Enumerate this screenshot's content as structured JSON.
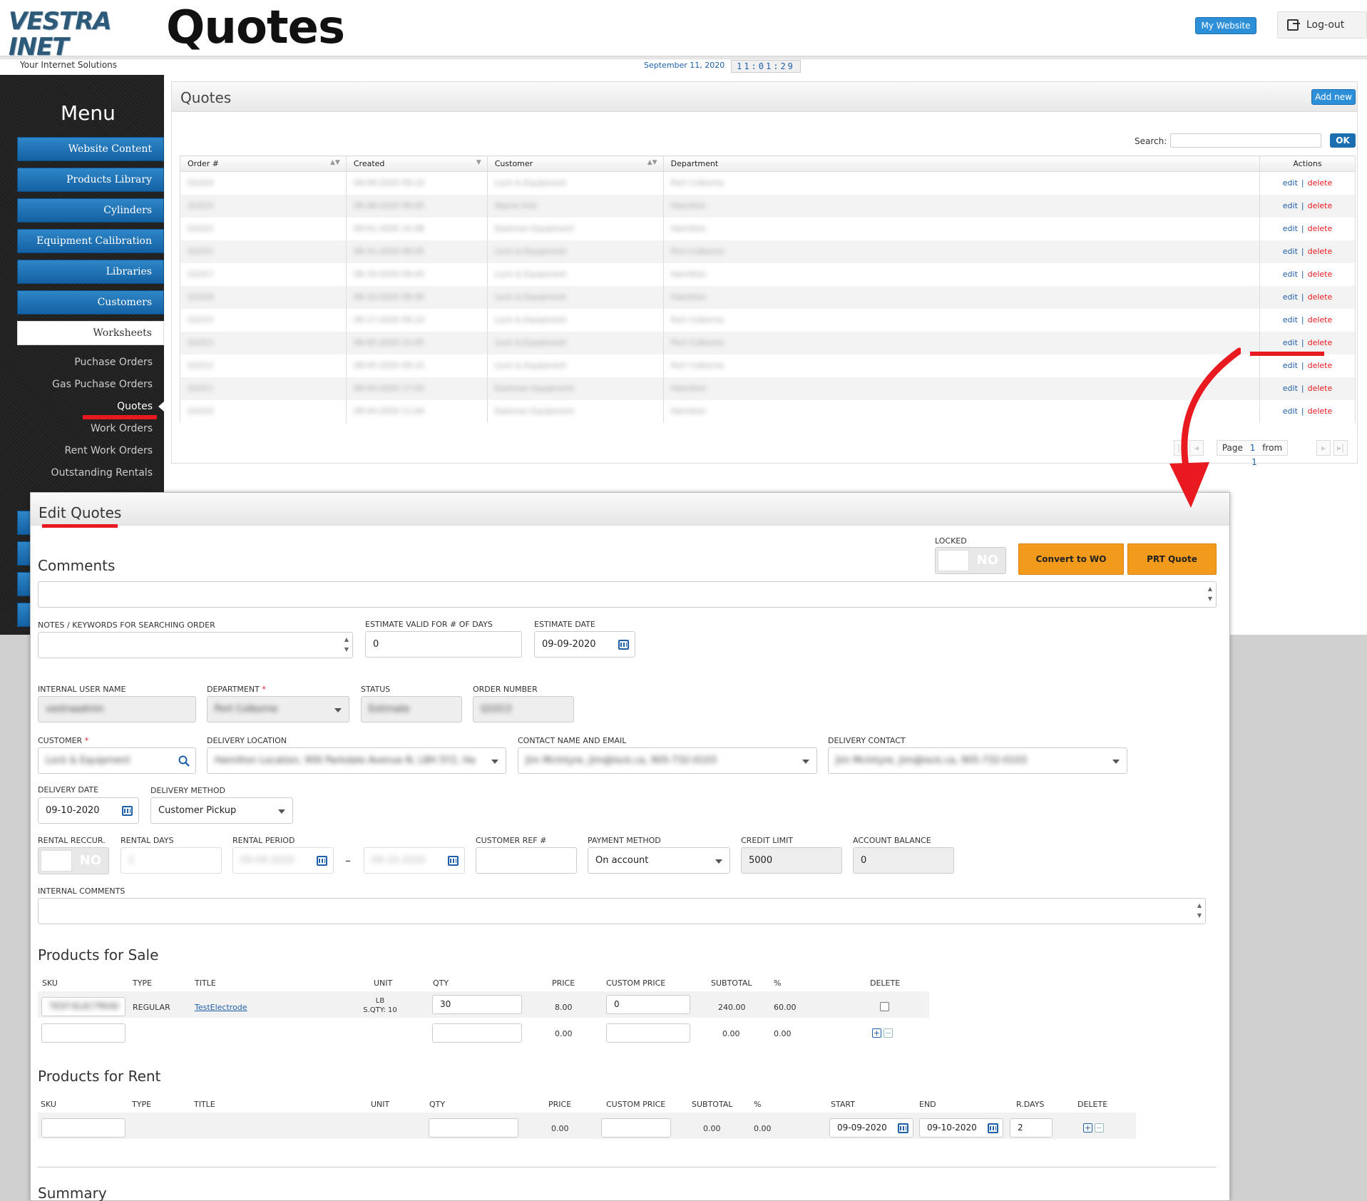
{
  "header": {
    "logo_text": "VESTRA INET",
    "logo_tagline": "Your Internet Solutions",
    "page_title": "Quotes",
    "my_website_label": "My Website",
    "logout_label": "Log-out",
    "date": "September 11, 2020",
    "time": "11:01:29"
  },
  "sidebar": {
    "title": "Menu",
    "buttons": [
      {
        "label": "Website Content"
      },
      {
        "label": "Products Library"
      },
      {
        "label": "Cylinders"
      },
      {
        "label": "Equipment Calibration"
      },
      {
        "label": "Libraries"
      },
      {
        "label": "Customers"
      },
      {
        "label": "Worksheets",
        "active": true
      }
    ],
    "subitems": [
      {
        "label": "Puchase Orders"
      },
      {
        "label": "Gas Puchase Orders"
      },
      {
        "label": "Quotes",
        "current": true
      },
      {
        "label": "Work Orders"
      },
      {
        "label": "Rent Work Orders"
      },
      {
        "label": "Outstanding Rentals"
      }
    ]
  },
  "quotes_panel": {
    "title": "Quotes",
    "add_new_label": "Add new",
    "search_label": "Search:",
    "search_value": "",
    "ok_label": "OK",
    "columns": [
      "Order #",
      "Created",
      "Customer",
      "Department",
      "Actions"
    ],
    "rows": [
      {
        "order": "Q1024",
        "created": "09-09-2020 09:10",
        "customer": "Lock & Equipment",
        "department": "Port Colborne"
      },
      {
        "order": "Q1023",
        "created": "09-08-2020 09:05",
        "customer": "Alpine Inet",
        "department": "Hamilton"
      },
      {
        "order": "Q1022",
        "created": "09-01-2020 10:48",
        "customer": "Eastman Equipment",
        "department": "Hamilton"
      },
      {
        "order": "Q1021",
        "created": "08-31-2020 09:05",
        "customer": "Lock & Equipment",
        "department": "Port Colborne"
      },
      {
        "order": "Q1017",
        "created": "08-19-2020 09:45",
        "customer": "Lock & Equipment",
        "department": "Hamilton"
      },
      {
        "order": "Q1016",
        "created": "08-19-2020 09:30",
        "customer": "Lock & Equipment",
        "department": "Hamilton"
      },
      {
        "order": "Q1015",
        "created": "08-17-2020 09:10",
        "customer": "Lock & Equipment",
        "department": "Port Colborne"
      },
      {
        "order": "Q1013",
        "created": "08-05-2020 15:05",
        "customer": "Lock & Equipment",
        "department": "Port Colborne"
      },
      {
        "order": "Q1012",
        "created": "08-05-2020 09:15",
        "customer": "Lock & Equipment",
        "department": "Port Colborne"
      },
      {
        "order": "Q1011",
        "created": "08-04-2020 17:02",
        "customer": "Eastman Equipment",
        "department": "Hamilton"
      },
      {
        "order": "Q1010",
        "created": "08-04-2020 11:04",
        "customer": "Eastman Equipment",
        "department": "Hamilton"
      }
    ],
    "edit_label": "edit",
    "delete_label": "delete",
    "separator": "|",
    "pager": {
      "page_label": "Page",
      "page": "1",
      "from_label": "from",
      "total": "1"
    }
  },
  "edit_quotes": {
    "title": "Edit Quotes",
    "locked_label": "LOCKED",
    "locked_value": "NO",
    "convert_label": "Convert to WO",
    "prt_label": "PRT Quote",
    "comments_title": "Comments",
    "notes_label": "NOTES / KEYWORDS FOR SEARCHING ORDER",
    "estimate_valid_label": "ESTIMATE VALID FOR # OF DAYS",
    "estimate_valid_value": "0",
    "estimate_date_label": "ESTIMATE DATE",
    "estimate_date_value": "09-09-2020",
    "internal_user_label": "INTERNAL USER NAME",
    "internal_user_value": "vestraadmin",
    "department_label": "DEPARTMENT",
    "department_value": "Port Colborne",
    "status_label": "STATUS",
    "status_value": "Estimate",
    "order_number_label": "ORDER NUMBER",
    "order_number_value": "Q1013",
    "customer_label": "CUSTOMER",
    "customer_value": "Lock & Equipment",
    "delivery_location_label": "DELIVERY LOCATION",
    "delivery_location_value": "Hamilton Location, 900 Parkdale Avenue N, L8H 5Y2, Ha",
    "contact_label": "CONTACT NAME AND EMAIL",
    "contact_value": "Jim McIntyre, Jim@lock.ca, 905-732-0103",
    "delivery_contact_label": "DELIVERY CONTACT",
    "delivery_contact_value": "Jim McIntyre, Jim@lock.ca, 905-732-0103",
    "delivery_date_label": "DELIVERY DATE",
    "delivery_date_value": "09-10-2020",
    "delivery_method_label": "DELIVERY METHOD",
    "delivery_method_value": "Customer Pickup",
    "rental_reccur_label": "RENTAL RECCUR.",
    "rental_reccur_value": "NO",
    "rental_days_label": "RENTAL DAYS",
    "rental_days_value": "2",
    "rental_period_label": "RENTAL PERIOD",
    "rental_period_from": "09-09-2020",
    "rental_period_dash": "–",
    "rental_period_to": "09-10-2020",
    "customer_ref_label": "CUSTOMER REF #",
    "customer_ref_value": "",
    "payment_method_label": "PAYMENT METHOD",
    "payment_method_value": "On account",
    "credit_limit_label": "CREDIT LIMIT",
    "credit_limit_value": "5000",
    "account_balance_label": "ACCOUNT BALANCE",
    "account_balance_value": "0",
    "internal_comments_label": "INTERNAL COMMENTS",
    "summary_title": "Summary"
  },
  "products_sale": {
    "title": "Products for Sale",
    "columns": [
      "SKU",
      "TYPE",
      "TITLE",
      "UNIT",
      "QTY",
      "PRICE",
      "CUSTOM PRICE",
      "SUBTOTAL",
      "%",
      "DELETE"
    ],
    "row": {
      "sku": "TEST-ELECTROD",
      "type": "REGULAR",
      "title": "TestElectrode",
      "unit": "LB",
      "sqty": "S.QTY: 10",
      "qty": "30",
      "price": "8.00",
      "custom_price": "0",
      "subtotal": "240.00",
      "percent": "60.00"
    },
    "blank_row": {
      "price": "0.00",
      "subtotal": "0.00",
      "percent": "0.00"
    }
  },
  "products_rent": {
    "title": "Products for Rent",
    "columns": [
      "SKU",
      "TYPE",
      "TITLE",
      "UNIT",
      "QTY",
      "PRICE",
      "CUSTOM PRICE",
      "SUBTOTAL",
      "%",
      "START",
      "END",
      "R.DAYS",
      "DELETE"
    ],
    "row": {
      "price": "0.00",
      "subtotal": "0.00",
      "percent": "0.00",
      "start": "09-09-2020",
      "end": "09-10-2020",
      "rdays": "2"
    }
  },
  "colors": {
    "accent_blue": "#1e5fa8",
    "button_blue": "#2d8fd8",
    "orange": "#f29a1b",
    "annotation_red": "#e8191f",
    "sidebar_bg": "#222222"
  },
  "icons": [
    "logout-icon",
    "search-icon",
    "calendar-icon",
    "chevron-down-icon",
    "plus-icon",
    "minus-icon",
    "sort-icon",
    "pager-first-icon",
    "pager-prev-icon",
    "pager-next-icon",
    "pager-last-icon"
  ]
}
